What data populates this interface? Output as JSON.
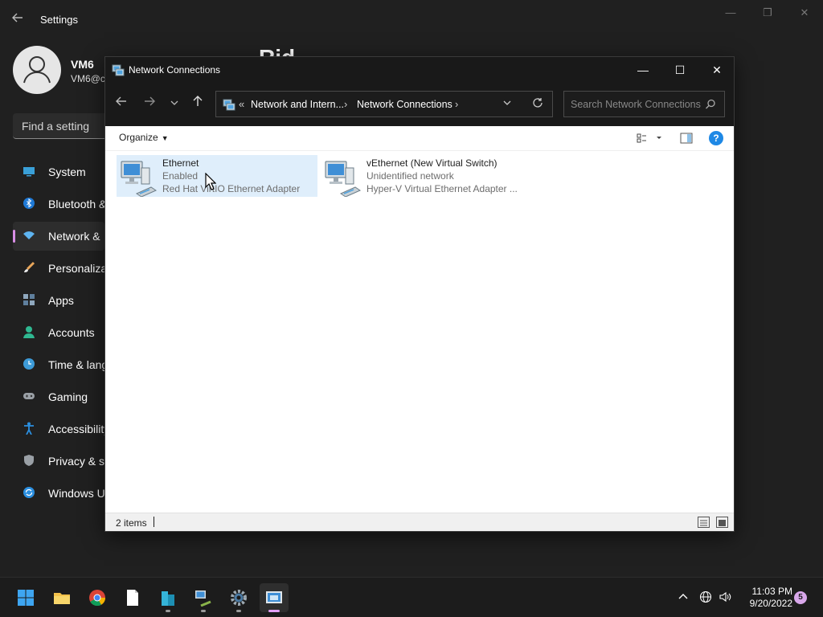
{
  "settings": {
    "title": "Settings",
    "user_name": "VM6",
    "user_email": "VM6@c",
    "page_heading": "Rid",
    "search_placeholder": "Find a setting",
    "nav": [
      {
        "label": "System",
        "icon": "monitor-icon"
      },
      {
        "label": "Bluetooth &",
        "icon": "bluetooth-icon"
      },
      {
        "label": "Network &",
        "icon": "wifi-icon",
        "active": true
      },
      {
        "label": "Personaliza",
        "icon": "brush-icon"
      },
      {
        "label": "Apps",
        "icon": "apps-icon"
      },
      {
        "label": "Accounts",
        "icon": "person-icon"
      },
      {
        "label": "Time & lang",
        "icon": "clock-globe-icon"
      },
      {
        "label": "Gaming",
        "icon": "gamepad-icon"
      },
      {
        "label": "Accessibility",
        "icon": "accessibility-icon"
      },
      {
        "label": "Privacy & se",
        "icon": "shield-icon"
      },
      {
        "label": "Windows U",
        "icon": "update-icon"
      }
    ]
  },
  "network_window": {
    "title": "Network Connections",
    "address": {
      "prefix": "«",
      "crumbs": [
        "Network and Intern...",
        "Network Connections"
      ]
    },
    "search_placeholder": "Search Network Connections",
    "organize_label": "Organize",
    "items": [
      {
        "name": "Ethernet",
        "status": "Enabled",
        "adapter": "Red Hat VirtIO Ethernet Adapter",
        "selected": true
      },
      {
        "name": "vEthernet (New Virtual Switch)",
        "status": "Unidentified network",
        "adapter": "Hyper-V Virtual Ethernet Adapter ...",
        "selected": false
      }
    ],
    "status_count": "2 items"
  },
  "taskbar": {
    "apps": [
      "start-icon",
      "file-explorer-icon",
      "chrome-icon",
      "notepad-icon",
      "building-app-icon",
      "network-computer-icon",
      "settings-gear-icon",
      "network-connections-icon"
    ],
    "time": "11:03 PM",
    "date": "9/20/2022",
    "notification_count": "5"
  },
  "colors": {
    "accent": "#e39ff6",
    "selection": "#dfeefb",
    "titlebar": "#191919",
    "help_blue": "#1e88e5"
  }
}
